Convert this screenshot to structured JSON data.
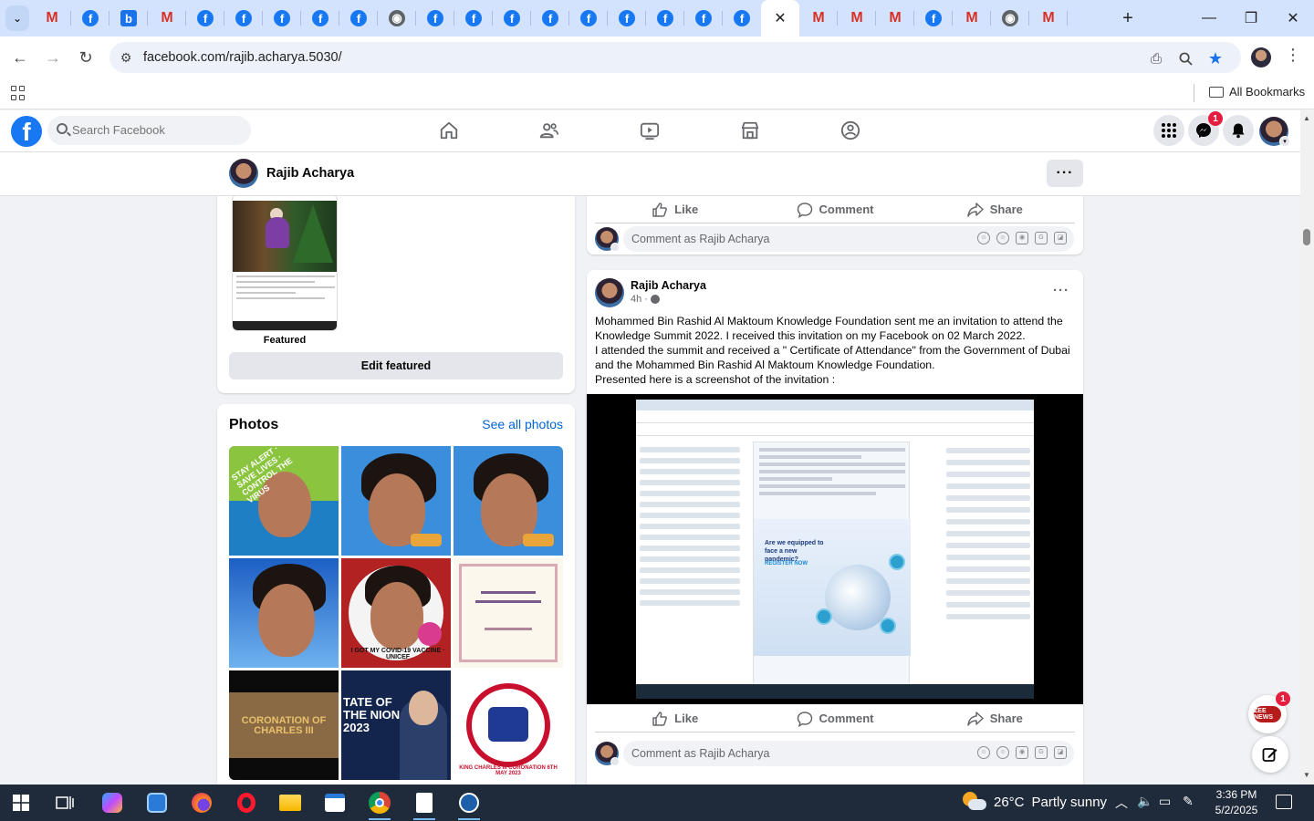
{
  "browser": {
    "tabs": [
      {
        "kind": "gm"
      },
      {
        "kind": "fb"
      },
      {
        "kind": "bg"
      },
      {
        "kind": "gm"
      },
      {
        "kind": "fb"
      },
      {
        "kind": "fb"
      },
      {
        "kind": "fb"
      },
      {
        "kind": "fb"
      },
      {
        "kind": "fb"
      },
      {
        "kind": "gl"
      },
      {
        "kind": "fb"
      },
      {
        "kind": "fb"
      },
      {
        "kind": "fb"
      },
      {
        "kind": "fb"
      },
      {
        "kind": "fb"
      },
      {
        "kind": "fb"
      },
      {
        "kind": "fb"
      },
      {
        "kind": "fb"
      },
      {
        "kind": "fb"
      },
      {
        "kind": "active"
      },
      {
        "kind": "gm"
      },
      {
        "kind": "gm"
      },
      {
        "kind": "gm"
      },
      {
        "kind": "fb"
      },
      {
        "kind": "gm"
      },
      {
        "kind": "gl"
      },
      {
        "kind": "gm"
      }
    ],
    "url": "facebook.com/rajib.acharya.5030/",
    "all_bookmarks": "All Bookmarks"
  },
  "facebook": {
    "search_placeholder": "Search Facebook",
    "messenger_badge": "1",
    "profile_name": "Rajib Acharya"
  },
  "featured": {
    "label": "Featured",
    "edit_button": "Edit featured"
  },
  "photos": {
    "title": "Photos",
    "see_all": "See all photos",
    "tiles": [
      {
        "text": "STAY ALERT · SAVE LIVES · CONTROL THE VIRUS"
      },
      {
        "text": ""
      },
      {
        "text": ""
      },
      {
        "text": ""
      },
      {
        "text": "I GOT MY COVID-19 VACCINE · UNICEF"
      },
      {
        "text": ""
      },
      {
        "text": "CORONATION OF CHARLES III"
      },
      {
        "text": "TATE OF THE NION 2023"
      },
      {
        "text": "KING CHARLES III CORONATION 6TH MAY 2023"
      }
    ]
  },
  "post_actions": {
    "like": "Like",
    "comment": "Comment",
    "share": "Share",
    "comment_placeholder": "Comment as Rajib Acharya"
  },
  "post": {
    "author": "Rajib Acharya",
    "time": "4h ·",
    "paragraphs": [
      "Mohammed Bin Rashid Al Maktoum Knowledge Foundation sent me an invitation to attend the Knowledge Summit 2022. I received this invitation on my Facebook on 02 March 2022.",
      "I attended the summit and received a \" Certificate of Attendance\" from the Government of Dubai and the   Mohammed Bin Rashid Al Maktoum Knowledge Foundation.",
      "Presented here is a screenshot of the invitation :"
    ],
    "image_texts": {
      "headline": "Are we equipped to face a new pandemic?",
      "cta": "REGISTER NOW"
    }
  },
  "floating": {
    "zeenews_badge": "1",
    "zeenews_label": "ZEE NEWS"
  },
  "taskbar": {
    "temperature": "26°C",
    "weather": "Partly sunny",
    "time": "3:36 PM",
    "date": "5/2/2025"
  }
}
